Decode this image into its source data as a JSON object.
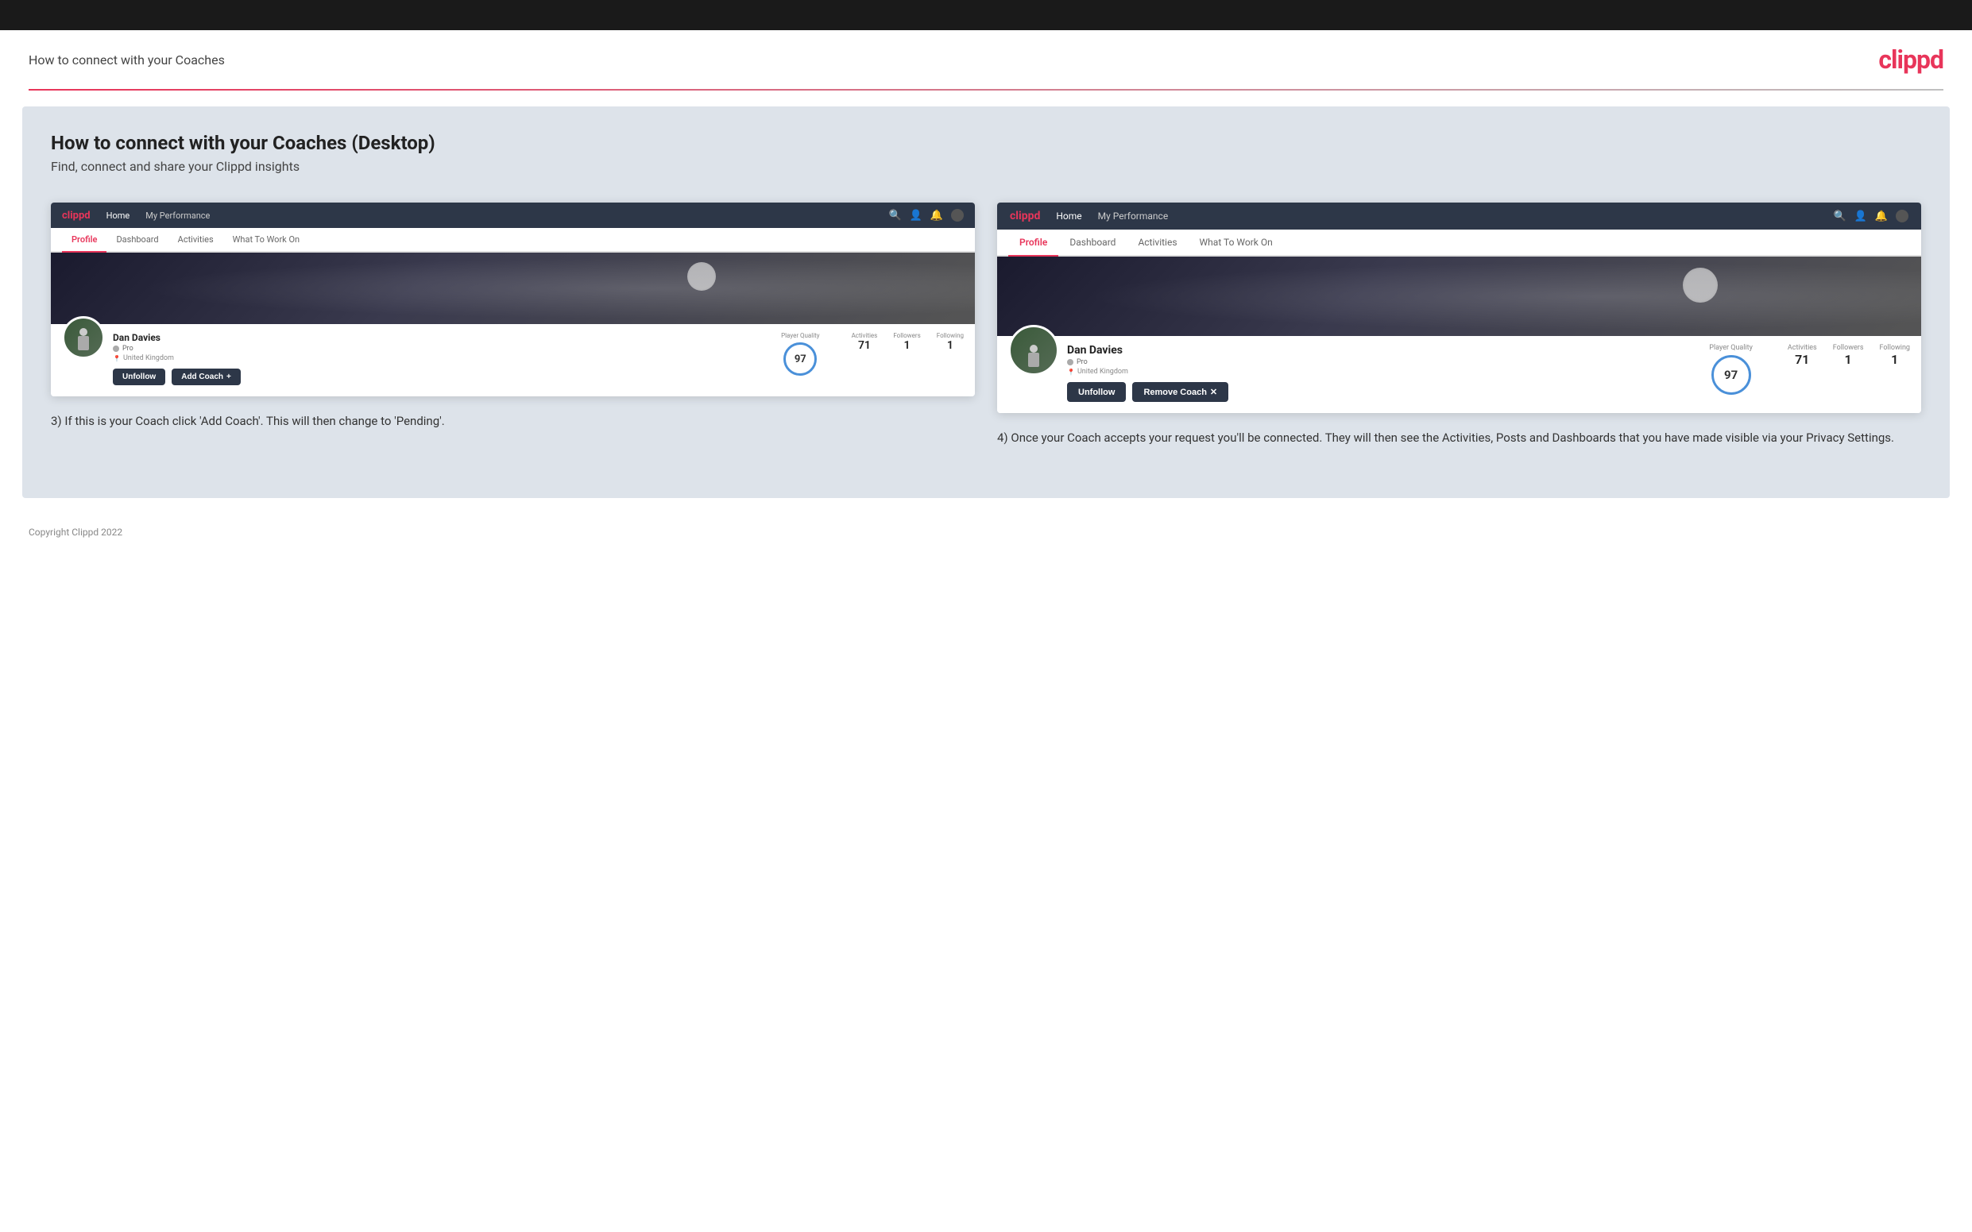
{
  "top_bar": {},
  "header": {
    "title": "How to connect with your Coaches",
    "logo": "clippd"
  },
  "page": {
    "heading": "How to connect with your Coaches (Desktop)",
    "subheading": "Find, connect and share your Clippd insights"
  },
  "left_screenshot": {
    "nav": {
      "logo": "clippd",
      "items": [
        "Home",
        "My Performance"
      ],
      "icons": [
        "search",
        "user",
        "bell",
        "avatar"
      ]
    },
    "tabs": [
      "Profile",
      "Dashboard",
      "Activities",
      "What To Work On"
    ],
    "active_tab": "Profile",
    "profile": {
      "name": "Dan Davies",
      "badge": "Pro",
      "location": "United Kingdom",
      "player_quality_label": "Player Quality",
      "player_quality_value": "97",
      "stats": [
        {
          "label": "Activities",
          "value": "71"
        },
        {
          "label": "Followers",
          "value": "1"
        },
        {
          "label": "Following",
          "value": "1"
        }
      ],
      "buttons": [
        "Unfollow",
        "Add Coach"
      ]
    }
  },
  "right_screenshot": {
    "nav": {
      "logo": "clippd",
      "items": [
        "Home",
        "My Performance"
      ],
      "icons": [
        "search",
        "user",
        "bell",
        "avatar"
      ]
    },
    "tabs": [
      "Profile",
      "Dashboard",
      "Activities",
      "What To Work On"
    ],
    "active_tab": "Profile",
    "profile": {
      "name": "Dan Davies",
      "badge": "Pro",
      "location": "United Kingdom",
      "player_quality_label": "Player Quality",
      "player_quality_value": "97",
      "stats": [
        {
          "label": "Activities",
          "value": "71"
        },
        {
          "label": "Followers",
          "value": "1"
        },
        {
          "label": "Following",
          "value": "1"
        }
      ],
      "buttons": [
        "Unfollow",
        "Remove Coach"
      ]
    }
  },
  "left_description": "3) If this is your Coach click 'Add Coach'. This will then change to 'Pending'.",
  "right_description": "4) Once your Coach accepts your request you'll be connected. They will then see the Activities, Posts and Dashboards that you have made visible via your Privacy Settings.",
  "footer": "Copyright Clippd 2022"
}
